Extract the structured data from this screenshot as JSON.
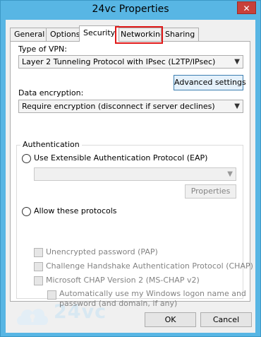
{
  "window": {
    "title": "24vc Properties",
    "close_glyph": "✕"
  },
  "tabs": [
    {
      "label": "General"
    },
    {
      "label": "Options"
    },
    {
      "label": "Security",
      "active": true
    },
    {
      "label": "Networking",
      "highlighted": true
    },
    {
      "label": "Sharing"
    }
  ],
  "security": {
    "vpn_type_label": "Type of VPN:",
    "vpn_type_value": "Layer 2 Tunneling Protocol with IPsec (L2TP/IPsec)",
    "advanced_settings_label": "Advanced settings",
    "encryption_label": "Data encryption:",
    "encryption_value": "Require encryption (disconnect if server declines)",
    "auth": {
      "legend": "Authentication",
      "eap_label": "Use Extensible Authentication Protocol (EAP)",
      "eap_value": "",
      "properties_label": "Properties",
      "allow_label": "Allow these protocols",
      "protocols": [
        {
          "label": "Unencrypted password (PAP)"
        },
        {
          "label": "Challenge Handshake Authentication Protocol (CHAP)"
        },
        {
          "label": "Microsoft CHAP Version 2 (MS-CHAP v2)"
        }
      ],
      "auto_logon_line1": "Automatically use my Windows logon name and",
      "auto_logon_line2": "password (and domain, if any)"
    }
  },
  "footer": {
    "ok_label": "OK",
    "cancel_label": "Cancel"
  },
  "watermark": {
    "text": "24vc"
  },
  "colors": {
    "highlight": "#e01919",
    "title_bar": "#58b6e4",
    "close_button": "#c8413a"
  }
}
